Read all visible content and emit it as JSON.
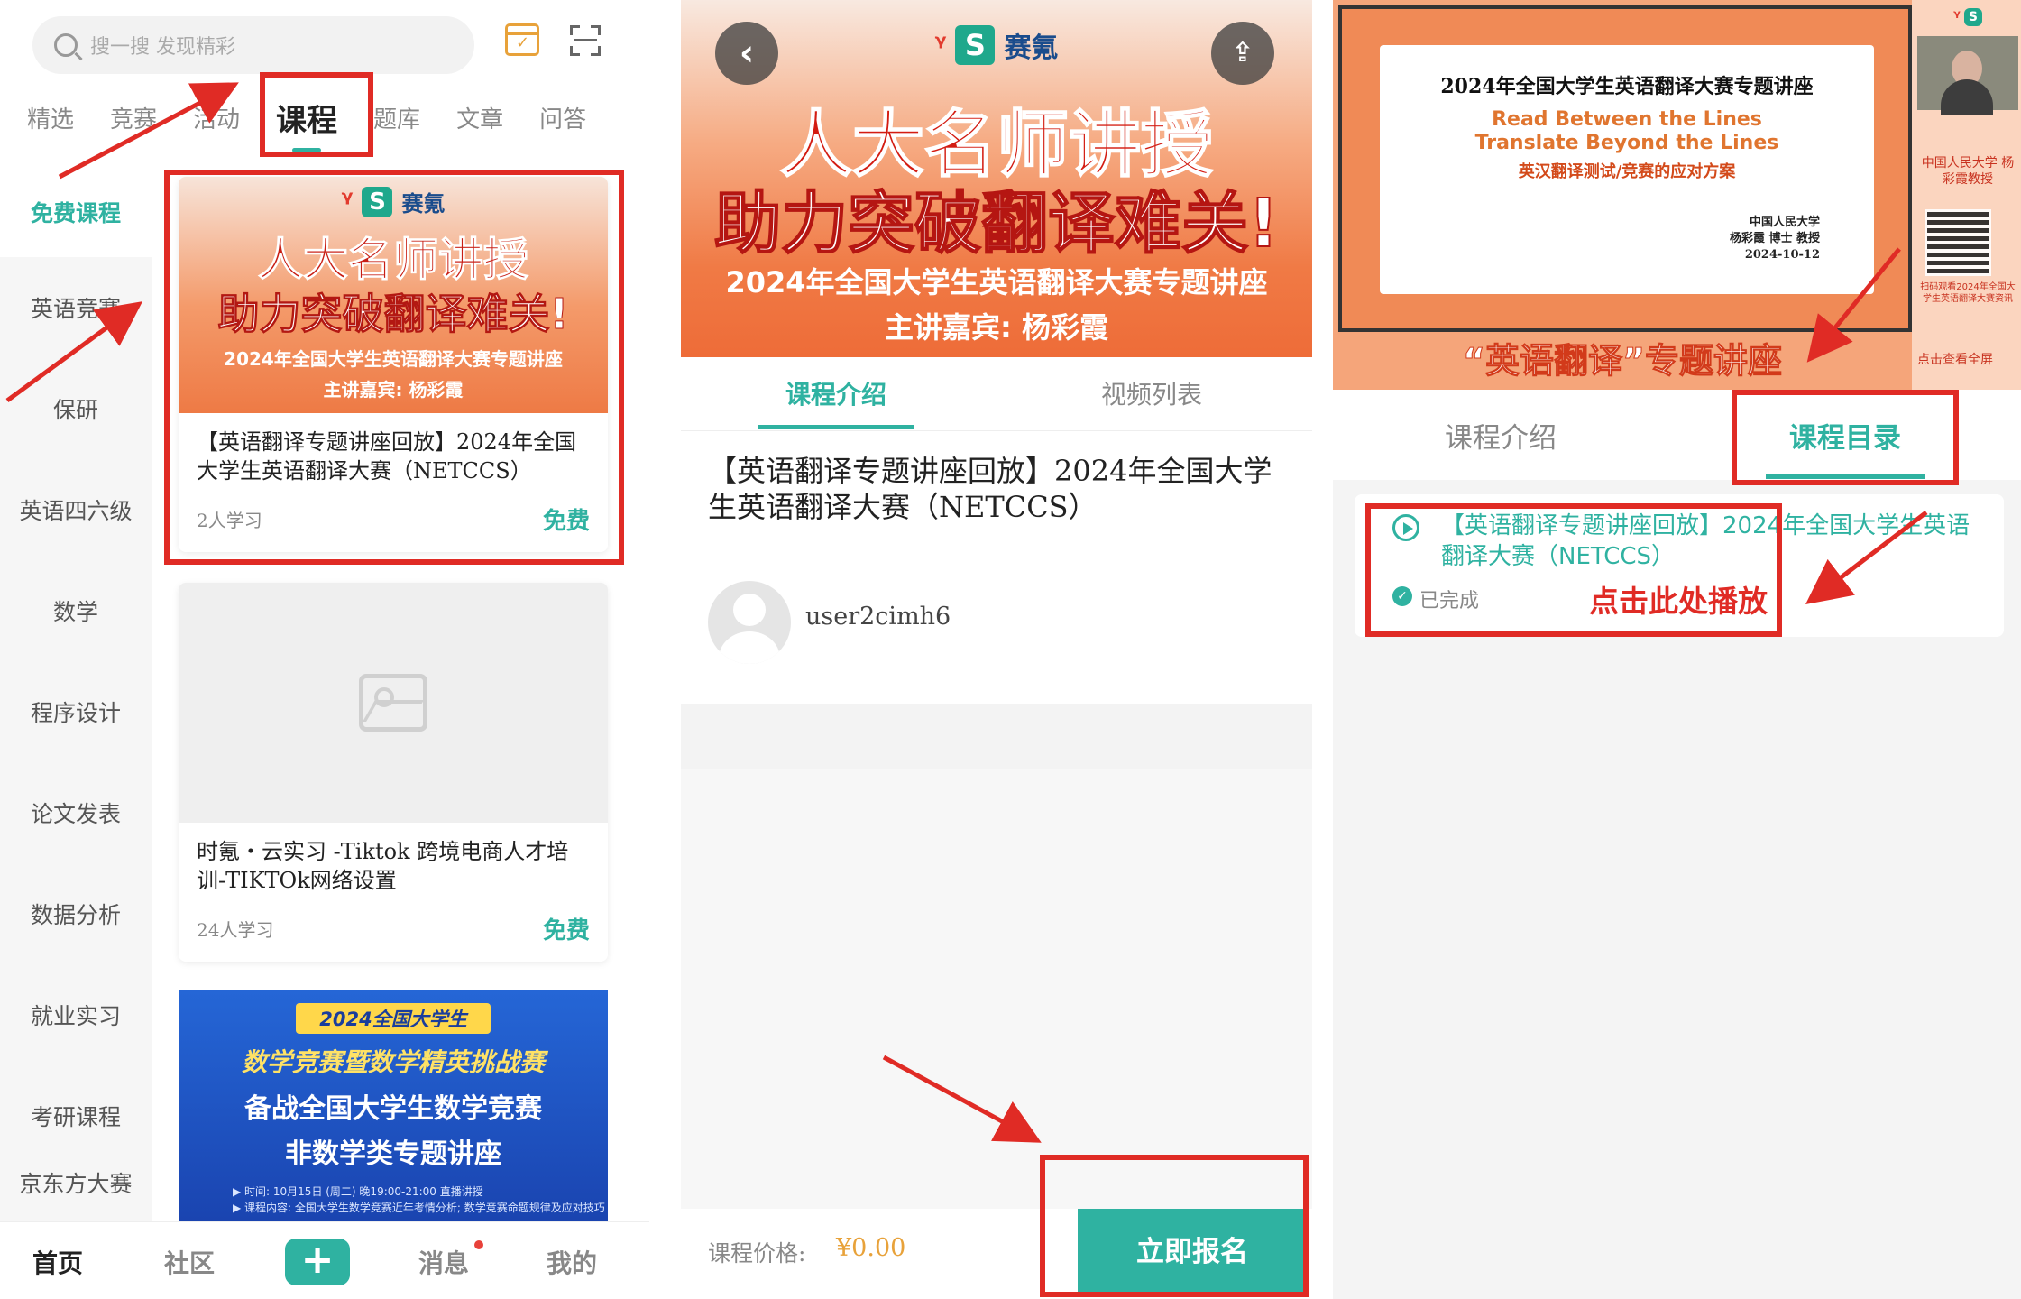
{
  "panel1": {
    "search": {
      "placeholder": "搜一搜 发现精彩"
    },
    "tabs": [
      "精选",
      "竞赛",
      "活动",
      "课程",
      "题库",
      "文章",
      "问答"
    ],
    "active_tab": "课程",
    "sidebar": [
      "免费课程",
      "英语竞赛",
      "保研",
      "英语四六级",
      "数学",
      "程序设计",
      "论文发表",
      "数据分析",
      "就业实习",
      "考研课程",
      "京东方大赛"
    ],
    "card1": {
      "banner_brand": "赛氪",
      "banner_line1": "人大名师讲授",
      "banner_line2": "助力突破翻译难关!",
      "banner_line3": "2024年全国大学生英语翻译大赛专题讲座",
      "banner_line4": "主讲嘉宾: 杨彩霞",
      "title": "【英语翻译专题讲座回放】2024年全国大学生英语翻译大赛（NETCCS）",
      "learners": "2人学习",
      "price_tag": "免费"
    },
    "card2": {
      "title": "时氪・云实习 -Tiktok 跨境电商人才培训-TIKTOk网络设置",
      "learners": "24人学习",
      "price_tag": "免费"
    },
    "card3": {
      "tag": "2024全国大学生",
      "line1": "数学竞赛暨数学精英挑战赛",
      "line2": "备战全国大学生数学竞赛",
      "line3": "非数学类专题讲座",
      "detail1": "▶ 时间: 10月15日 (周二) 晚19:00-21:00 直播讲授",
      "detail2": "▶ 课程内容: 全国大学生数学竞赛近年考情分析; 数学竞赛命题规律及应对技巧"
    },
    "bottom_nav": [
      "首页",
      "社区",
      "消息",
      "我的"
    ]
  },
  "panel2": {
    "hero": {
      "brand": "赛氪",
      "line1": "人大名师讲授",
      "line2": "助力突破翻译难关!",
      "line3": "2024年全国大学生英语翻译大赛专题讲座",
      "line4": "主讲嘉宾: 杨彩霞"
    },
    "tabs": [
      "课程介绍",
      "视频列表"
    ],
    "title": "【英语翻译专题讲座回放】2024年全国大学生英语翻译大赛（NETCCS）",
    "username": "user2cimh6",
    "price_label": "课程价格:",
    "price_value": "¥0.00",
    "enroll_label": "立即报名"
  },
  "panel3": {
    "slide": {
      "title": "2024年全国大学生英语翻译大赛专题讲座",
      "en1": "Read Between the Lines",
      "en2": "Translate Beyond the Lines",
      "zh": "英汉翻译测试/竞赛的应对方案",
      "sign1": "中国人民大学",
      "sign2": "杨彩霞 博士 教授",
      "sign3": "2024-10-12"
    },
    "strip_text": "中国人民大学 杨彩霞教授",
    "qr_text": "扫码观看2024年全国大学生英语翻译大赛资讯",
    "banner": "“英语翻译”专题讲座",
    "fullscreen": "点击查看全屏",
    "tabs": [
      "课程介绍",
      "课程目录"
    ],
    "item_title": "【英语翻译专题讲座回放】2024年全国大学生英语翻译大赛（NETCCS）",
    "item_status": "已完成",
    "play_hint": "点击此处播放"
  }
}
